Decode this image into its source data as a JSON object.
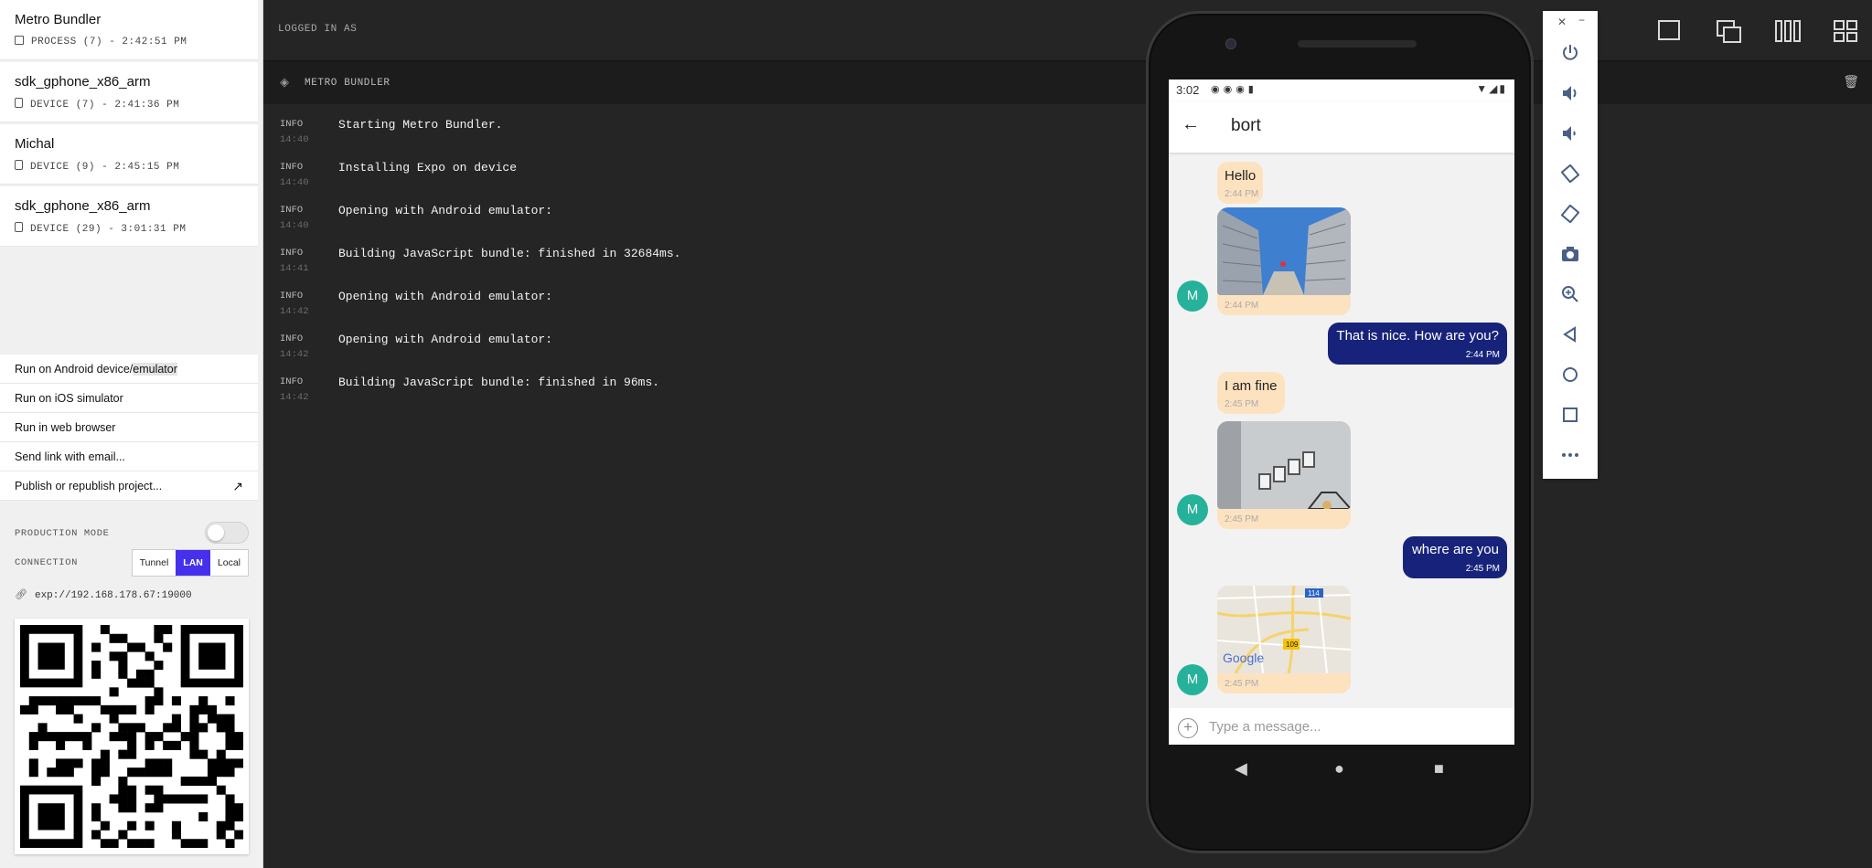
{
  "sidebar": {
    "processes": [
      {
        "title": "Metro Bundler",
        "subtitle": "PROCESS (7) - 2:42:51 PM",
        "icon": "box-icon"
      },
      {
        "title": "sdk_gphone_x86_arm",
        "subtitle": "DEVICE (7) - 2:41:36 PM",
        "icon": "device-icon"
      },
      {
        "title": "Michal",
        "subtitle": "DEVICE (9) - 2:45:15 PM",
        "icon": "device-icon"
      },
      {
        "title": "sdk_gphone_x86_arm",
        "subtitle": "DEVICE (29) - 3:01:31 PM",
        "icon": "device-icon"
      }
    ],
    "actions": {
      "run_android_prefix": "Run on Android device/",
      "run_android_highlight": "emulator",
      "run_ios": "Run on iOS simulator",
      "run_web": "Run in web browser",
      "send_link": "Send link with email...",
      "publish": "Publish or republish project..."
    },
    "production_mode_label": "PRODUCTION MODE",
    "production_mode_on": false,
    "connection_label": "CONNECTION",
    "connection_options": [
      "Tunnel",
      "LAN",
      "Local"
    ],
    "connection_selected": "LAN",
    "url": "exp://192.168.178.67:19000",
    "accent_color": "#4630eb"
  },
  "main": {
    "logged_in": "LOGGED IN AS",
    "log_title": "METRO BUNDLER",
    "logs": [
      {
        "level": "INFO",
        "time": "14:40",
        "message": "Starting Metro Bundler."
      },
      {
        "level": "INFO",
        "time": "14:40",
        "message": "Installing Expo on device"
      },
      {
        "level": "INFO",
        "time": "14:40",
        "message": "Opening with Android emulator:"
      },
      {
        "level": "INFO",
        "time": "14:41",
        "message": "Building JavaScript bundle: finished in 32684ms."
      },
      {
        "level": "INFO",
        "time": "14:42",
        "message": "Opening with Android emulator:"
      },
      {
        "level": "INFO",
        "time": "14:42",
        "message": "Opening with Android emulator:"
      },
      {
        "level": "INFO",
        "time": "14:42",
        "message": "Building JavaScript bundle: finished in 96ms."
      }
    ]
  },
  "phone": {
    "status_time": "3:02",
    "contact": "bort",
    "avatar_letter": "M",
    "messages": [
      {
        "type": "text-in",
        "text": "Hello",
        "time": "2:44 PM"
      },
      {
        "type": "image-in",
        "time": "2:44 PM"
      },
      {
        "type": "text-out",
        "text": "That is nice. How are you?",
        "time": "2:44 PM"
      },
      {
        "type": "text-in",
        "text": "I am fine",
        "time": "2:45 PM"
      },
      {
        "type": "image-in",
        "time": "2:45 PM"
      },
      {
        "type": "text-out",
        "text": "where are you",
        "time": "2:45 PM"
      },
      {
        "type": "map-in",
        "time": "2:45 PM"
      }
    ],
    "map_labels": {
      "logo": "Google",
      "road1": "114",
      "road2": "109"
    },
    "composer_placeholder": "Type a message...",
    "outgoing_color": "#17237a",
    "incoming_color": "#fde2c0"
  },
  "emulator_toolbar": [
    "power-icon",
    "volume-up-icon",
    "volume-down-icon",
    "rotate-left-icon",
    "rotate-right-icon",
    "camera-icon",
    "zoom-icon",
    "back-icon",
    "home-icon",
    "overview-icon",
    "more-icon"
  ]
}
